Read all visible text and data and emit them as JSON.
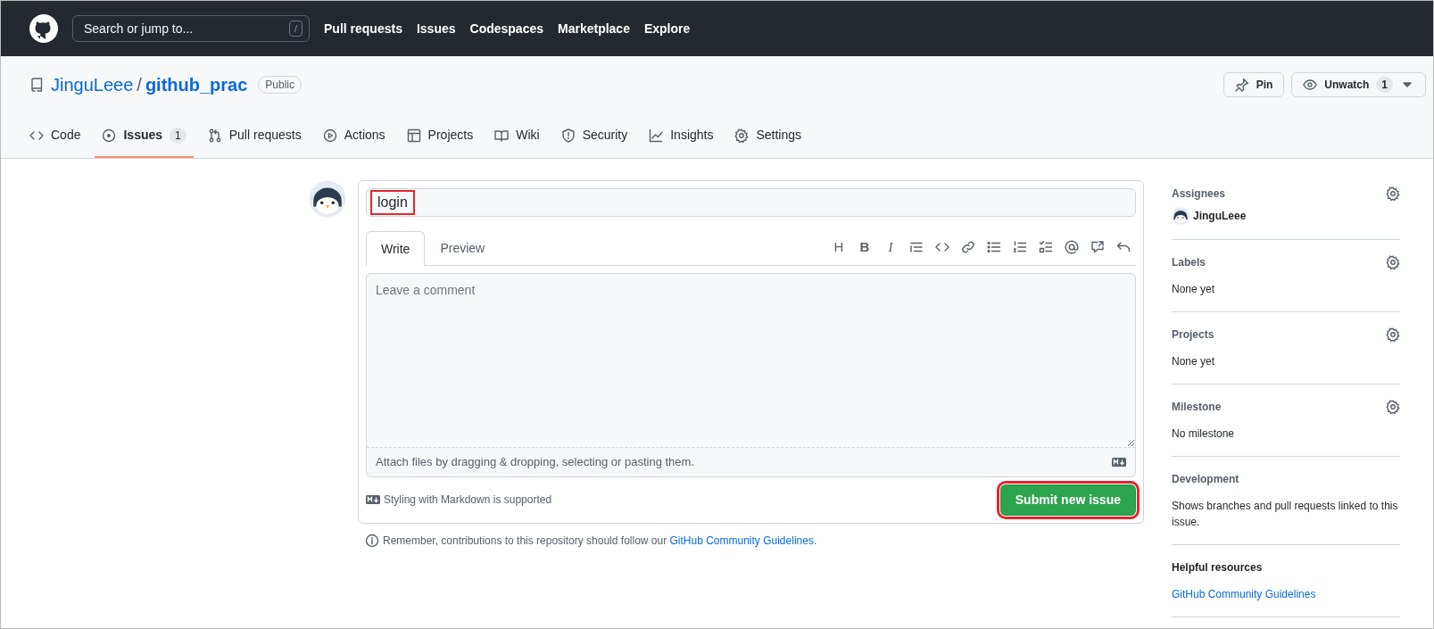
{
  "header": {
    "search": {
      "placeholder": "Search or jump to...",
      "shortcut": "/"
    },
    "links": [
      "Pull requests",
      "Issues",
      "Codespaces",
      "Marketplace",
      "Explore"
    ]
  },
  "repo": {
    "owner": "JinguLeee",
    "separator": "/",
    "name": "github_prac",
    "visibility": "Public",
    "actions": [
      {
        "kind": "pin",
        "label": "Pin"
      },
      {
        "kind": "watch",
        "label": "Unwatch",
        "count": "1",
        "dropdown": true
      }
    ]
  },
  "tabs": [
    {
      "kind": "code",
      "label": "Code",
      "selected": false
    },
    {
      "kind": "issue",
      "label": "Issues",
      "count": "1",
      "selected": true
    },
    {
      "kind": "pr",
      "label": "Pull requests",
      "selected": false
    },
    {
      "kind": "play",
      "label": "Actions",
      "selected": false
    },
    {
      "kind": "table",
      "label": "Projects",
      "selected": false
    },
    {
      "kind": "book",
      "label": "Wiki",
      "selected": false
    },
    {
      "kind": "shield",
      "label": "Security",
      "selected": false
    },
    {
      "kind": "graph",
      "label": "Insights",
      "selected": false
    },
    {
      "kind": "gear",
      "label": "Settings",
      "selected": false
    }
  ],
  "form": {
    "title": {
      "value": "login",
      "highlighted": true
    },
    "editor_tabs": [
      {
        "label": "Write",
        "selected": true
      },
      {
        "label": "Preview",
        "selected": false
      }
    ],
    "toolbar": [
      {
        "kind": "heading",
        "label": "H"
      },
      {
        "kind": "bold",
        "label": "B"
      },
      {
        "kind": "italic",
        "label": "I"
      },
      {
        "kind": "quote"
      },
      {
        "kind": "code"
      },
      {
        "kind": "link"
      },
      {
        "kind": "bulleted-list"
      },
      {
        "kind": "numbered-list"
      },
      {
        "kind": "task-list"
      },
      {
        "kind": "mention"
      },
      {
        "kind": "reference"
      },
      {
        "kind": "undo"
      }
    ],
    "comment": {
      "placeholder": "Leave a comment"
    },
    "attach_hint": "Attach files by dragging & dropping, selecting or pasting them.",
    "markdown_hint": "Styling with Markdown is supported",
    "submit": {
      "label": "Submit new issue",
      "highlighted": true
    },
    "note": {
      "text": "Remember, contributions to this repository should follow our",
      "link": "GitHub Community Guidelines",
      "end": "."
    }
  },
  "sidebar": [
    {
      "kind": "assignees",
      "title": "Assignees",
      "gear": true,
      "value": "JinguLeee"
    },
    {
      "kind": "text",
      "title": "Labels",
      "gear": true,
      "value": "None yet"
    },
    {
      "kind": "text",
      "title": "Projects",
      "gear": true,
      "value": "None yet"
    },
    {
      "kind": "text",
      "title": "Milestone",
      "gear": true,
      "value": "No milestone"
    },
    {
      "kind": "text",
      "title": "Development",
      "gear": false,
      "value": "Shows branches and pull requests linked to this issue."
    },
    {
      "kind": "link",
      "title": "Helpful resources",
      "gear": false,
      "value": "GitHub Community Guidelines"
    }
  ]
}
